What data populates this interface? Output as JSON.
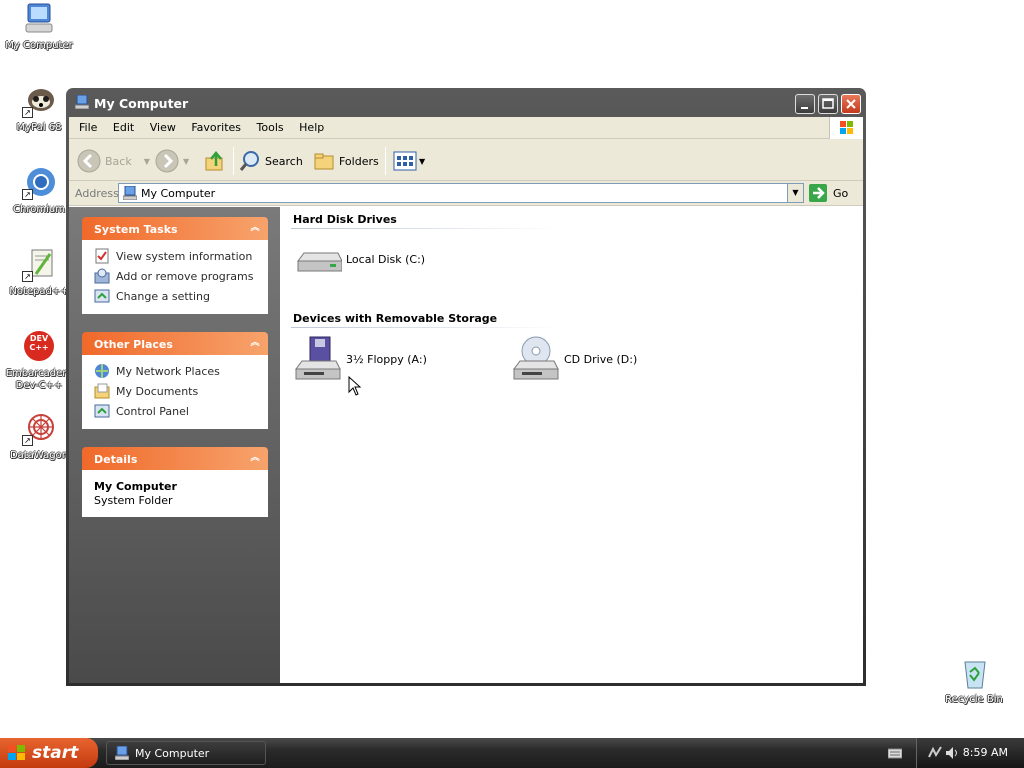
{
  "desktop": {
    "icons": [
      {
        "label": "My Computer",
        "icon": "my-computer-icon"
      },
      {
        "label": "MyPal 68",
        "icon": "mypal-icon"
      },
      {
        "label": "Chromium",
        "icon": "chromium-icon"
      },
      {
        "label": "Notepad++",
        "icon": "notepad-plus-plus-icon"
      },
      {
        "label": "Embarcadero Dev-C++",
        "icon": "dev-cpp-icon",
        "badge": "DEV C++"
      },
      {
        "label": "DataWagon",
        "icon": "datawagon-icon"
      },
      {
        "label": "Recycle Bin",
        "icon": "recycle-bin-icon"
      }
    ]
  },
  "window": {
    "title": "My Computer",
    "menu": [
      "File",
      "Edit",
      "View",
      "Favorites",
      "Tools",
      "Help"
    ],
    "toolbar": {
      "back": "Back",
      "search": "Search",
      "folders": "Folders"
    },
    "address": {
      "label": "Address",
      "value": "My Computer",
      "go": "Go"
    },
    "left_pane": {
      "system_tasks": {
        "title": "System Tasks",
        "items": [
          "View system information",
          "Add or remove programs",
          "Change a setting"
        ]
      },
      "other_places": {
        "title": "Other Places",
        "items": [
          "My Network Places",
          "My Documents",
          "Control Panel"
        ]
      },
      "details": {
        "title": "Details",
        "name": "My Computer",
        "type": "System Folder"
      }
    },
    "main": {
      "groups": [
        {
          "title": "Hard Disk Drives",
          "items": [
            {
              "label": "Local Disk (C:)",
              "icon": "hard-disk-icon"
            }
          ]
        },
        {
          "title": "Devices with Removable Storage",
          "items": [
            {
              "label": "3½ Floppy (A:)",
              "icon": "floppy-drive-icon"
            },
            {
              "label": "CD Drive (D:)",
              "icon": "cd-drive-icon"
            }
          ]
        }
      ]
    }
  },
  "taskbar": {
    "start": "start",
    "task_button": "My Computer",
    "clock": "8:59 AM"
  },
  "colors": {
    "panel_header_start": "#f0692a",
    "panel_header_end": "#f7a36c",
    "left_pane": "#5e5e5e",
    "titlebar": "#3c3c3c",
    "start_button": "#d4501e"
  }
}
